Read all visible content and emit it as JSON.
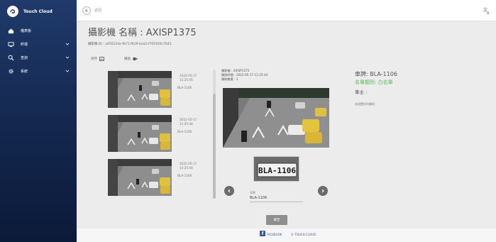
{
  "app": {
    "brand": "Touch Cloud"
  },
  "sidebar": {
    "items": [
      {
        "label": "儀表板",
        "icon": "dashboard-icon",
        "has_chevron": false
      },
      {
        "label": "終端",
        "icon": "device-icon",
        "has_chevron": true
      },
      {
        "label": "查詢",
        "icon": "search-icon",
        "has_chevron": true
      },
      {
        "label": "系統",
        "icon": "gear-icon",
        "has_chevron": true
      }
    ]
  },
  "topbar": {
    "back_label": "返回"
  },
  "page": {
    "title": "攝影機 名稱 : AXISP1375",
    "camera_id": "攝影機 ID : a45612de-fb71-fb19-bea5-f701926c7645",
    "tool_save": "另存",
    "tool_play": "播放"
  },
  "events": [
    {
      "timestamp": "2022-05-17\n11:25:45",
      "plate": "BLA-1106"
    },
    {
      "timestamp": "2022-05-17\n11:25:44",
      "plate": "BLA-1106"
    },
    {
      "timestamp": "2022-05-17\n11:25:44",
      "plate": "BLA-1106"
    }
  ],
  "detail": {
    "camera_line": "攝影機 : AXISP1375",
    "time_line": "擷取時間 : 2022-05-17 11:25:44",
    "count_line": "擷取數量 : 1",
    "plate_label": "車牌",
    "plate_value": "BLA-1106",
    "plate_image_text": "BLA-1106"
  },
  "right_panel": {
    "plate": "車牌: BLA-1106",
    "list_type": "名單類別: 白名單",
    "owner": "車主 :",
    "note": "未設置任何資料"
  },
  "actions": {
    "confirm_label": "確定"
  },
  "footer": {
    "facebook_label": "FACEBOOK",
    "touchcloud_label": "© TOUCH CLOUD"
  },
  "colors": {
    "sidebar_top": "#1f3a6b",
    "sidebar_bottom": "#0b1a38",
    "list_green": "#5cb85c",
    "facebook_blue": "#3b5998",
    "button_gray": "#8e8e8e"
  }
}
